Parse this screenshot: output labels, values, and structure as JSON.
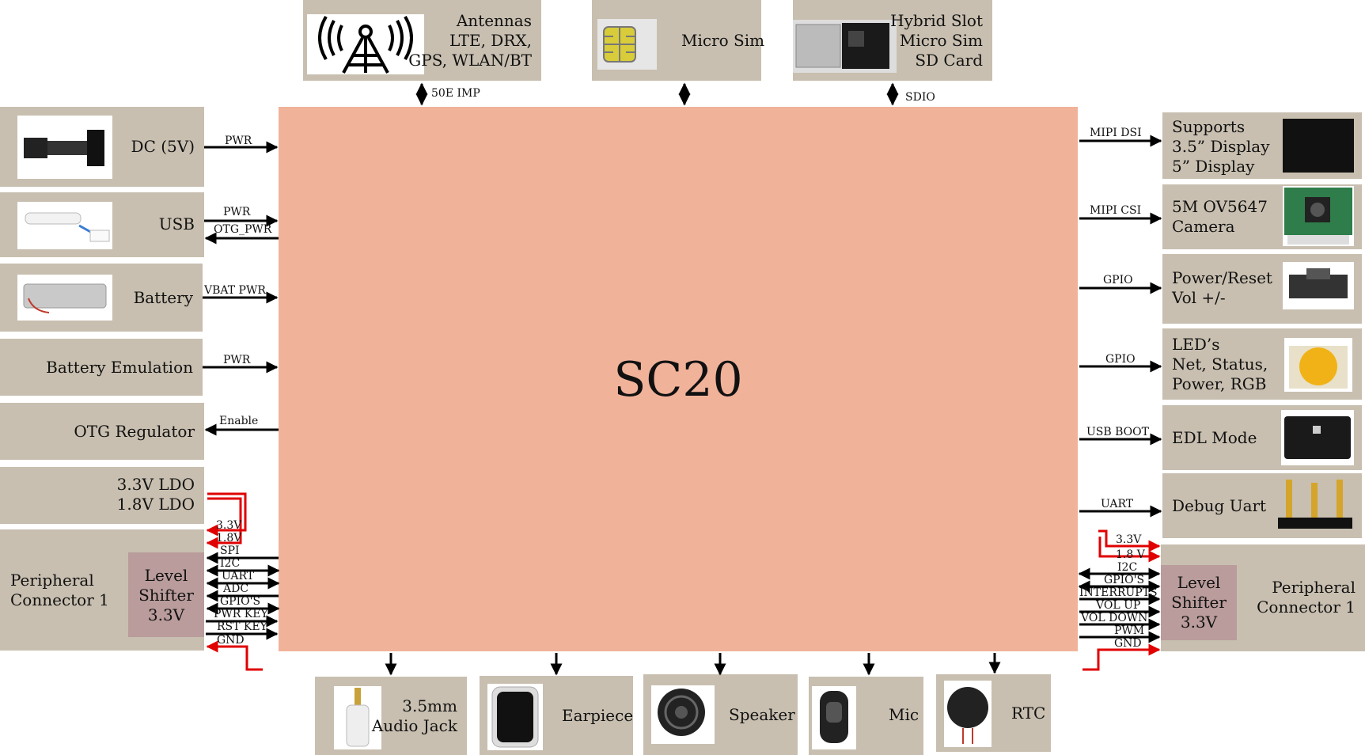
{
  "core": {
    "title": "SC20"
  },
  "top": {
    "antennas": {
      "lines": [
        "Antennas",
        "LTE, DRX,",
        "GPS, WLAN/BT"
      ],
      "signal": "50E IMP",
      "icon": "antenna-tower-icon"
    },
    "microsim": {
      "lines": [
        "Micro Sim"
      ],
      "icon": "sim-card-icon"
    },
    "hybrid": {
      "lines": [
        "Hybrid Slot",
        "Micro Sim",
        "SD Card"
      ],
      "signal": "SDIO",
      "icon": "sd-card-icon"
    }
  },
  "left": {
    "dc": {
      "label": "DC (5V)",
      "signal": "PWR",
      "icon": "dc-jack-icon"
    },
    "usb": {
      "label": "USB",
      "signals": [
        "PWR",
        "OTG_PWR"
      ],
      "icon": "usb-cable-icon"
    },
    "battery": {
      "label": "Battery",
      "signal": "VBAT PWR",
      "icon": "battery-icon"
    },
    "battery_emulation": {
      "label": "Battery Emulation",
      "signal": "PWR"
    },
    "otg": {
      "label": "OTG Regulator",
      "signal": "Enable"
    },
    "ldo": {
      "lines": [
        "3.3V LDO",
        "1.8V LDO"
      ]
    },
    "peripheral": {
      "lines": [
        "Peripheral",
        "Connector 1"
      ],
      "shifter": [
        "Level",
        "Shifter",
        "3.3V"
      ],
      "signals": [
        "3.3V",
        "1.8V",
        "SPI",
        "I2C",
        "UART",
        "ADC",
        "GPIO'S",
        "PWR KEY",
        "RST KEY",
        "GND"
      ]
    }
  },
  "right": {
    "display": {
      "lines": [
        "Supports",
        "3.5” Display",
        "5” Display"
      ],
      "signal": "MIPI DSI",
      "icon": "display-panel-icon"
    },
    "camera": {
      "lines": [
        "5M OV5647",
        "Camera"
      ],
      "signal": "MIPI CSI",
      "icon": "camera-module-icon"
    },
    "buttons": {
      "lines": [
        "Power/Reset",
        "Vol +/-"
      ],
      "signal": "GPIO",
      "icon": "tactile-switch-icon"
    },
    "leds": {
      "lines": [
        "LED’s",
        "Net, Status,",
        "Power, RGB"
      ],
      "signal": "GPIO",
      "icon": "led-icon"
    },
    "edl": {
      "label": "EDL Mode",
      "signal": "USB BOOT",
      "icon": "slide-switch-icon"
    },
    "debug": {
      "label": "Debug Uart",
      "signal": "UART",
      "icon": "pin-header-icon"
    },
    "peripheral": {
      "lines": [
        "Peripheral",
        "Connector 1"
      ],
      "shifter": [
        "Level",
        "Shifter",
        "3.3V"
      ],
      "signals": [
        "3.3V",
        "1.8 V",
        "I2C",
        "GPIO'S",
        "INTERRUPTS",
        "VOL UP",
        "VOL DOWN",
        "PWM",
        "GND"
      ]
    }
  },
  "bottom": {
    "jack": {
      "lines": [
        "3.5mm",
        "Audio Jack"
      ],
      "icon": "audio-jack-icon"
    },
    "earpiece": {
      "label": "Earpiece",
      "icon": "earpiece-icon"
    },
    "speaker": {
      "label": "Speaker",
      "icon": "speaker-icon"
    },
    "mic": {
      "label": "Mic",
      "icon": "microphone-icon"
    },
    "rtc": {
      "label": "RTC",
      "icon": "coin-cell-icon"
    }
  },
  "colors": {
    "core": "#f1b29a",
    "box": "#c8bfb0",
    "shifter": "#b99c9b",
    "power_wire": "#e00000",
    "wire": "#000000"
  }
}
